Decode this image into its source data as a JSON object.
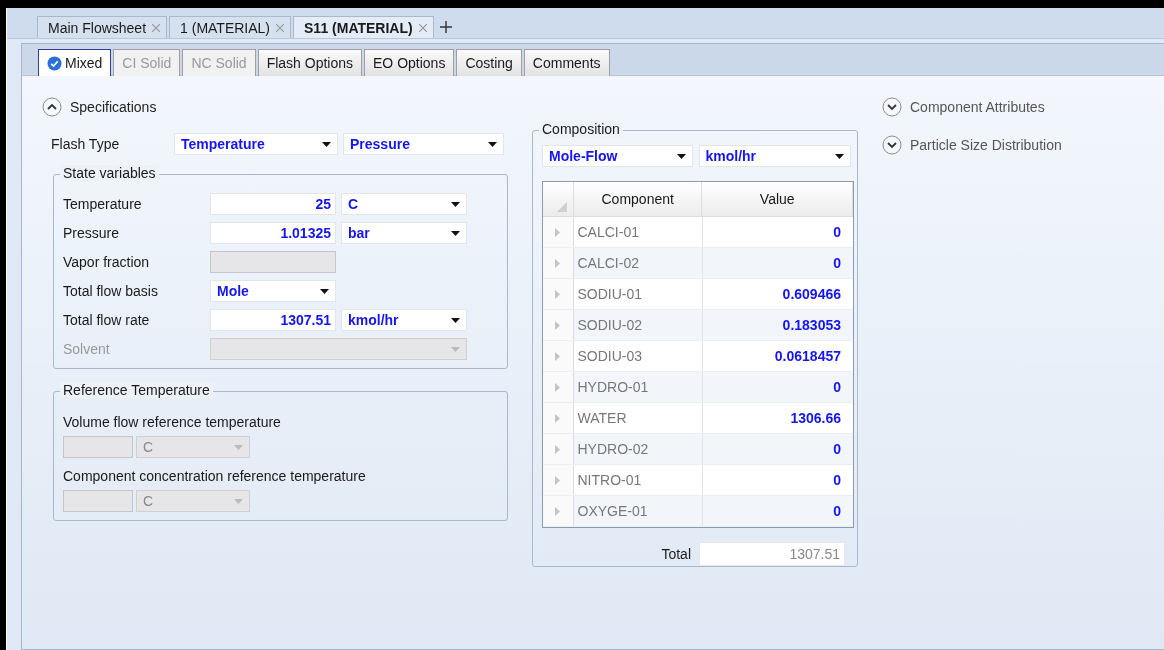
{
  "document_tabs": [
    {
      "label": "Main Flowsheet",
      "selected": false
    },
    {
      "label": "1 (MATERIAL)",
      "selected": false
    },
    {
      "label": "S11 (MATERIAL)",
      "selected": true
    }
  ],
  "form_tabs": [
    {
      "label": "Mixed",
      "selected": true,
      "disabled": false,
      "checked": true
    },
    {
      "label": "CI Solid",
      "selected": false,
      "disabled": true,
      "checked": false
    },
    {
      "label": "NC Solid",
      "selected": false,
      "disabled": true,
      "checked": false
    },
    {
      "label": "Flash Options",
      "selected": false,
      "disabled": false,
      "checked": false
    },
    {
      "label": "EO Options",
      "selected": false,
      "disabled": false,
      "checked": false
    },
    {
      "label": "Costing",
      "selected": false,
      "disabled": false,
      "checked": false
    },
    {
      "label": "Comments",
      "selected": false,
      "disabled": false,
      "checked": false
    }
  ],
  "specifications": {
    "title": "Specifications",
    "expanded": true,
    "flash_type": {
      "label": "Flash Type",
      "options": [
        "Temperature",
        "Pressure"
      ]
    },
    "state_variables": {
      "title": "State variables",
      "rows": [
        {
          "kind": "value_unit",
          "label": "Temperature",
          "value": "25",
          "unit": "C",
          "disabled": false
        },
        {
          "kind": "value_unit",
          "label": "Pressure",
          "value": "1.01325",
          "unit": "bar",
          "disabled": false
        },
        {
          "kind": "empty_input",
          "label": "Vapor fraction",
          "disabled": false
        },
        {
          "kind": "select",
          "label": "Total flow basis",
          "value": "Mole",
          "disabled": false
        },
        {
          "kind": "value_unit",
          "label": "Total flow rate",
          "value": "1307.51",
          "unit": "kmol/hr",
          "disabled": false
        },
        {
          "kind": "wide_select",
          "label": "Solvent",
          "disabled": true
        }
      ]
    },
    "reference_temperature": {
      "title": "Reference Temperature",
      "items": [
        {
          "label": "Volume flow reference temperature",
          "unit": "C"
        },
        {
          "label": "Component concentration reference temperature",
          "unit": "C"
        }
      ]
    }
  },
  "composition": {
    "title": "Composition",
    "basis": "Mole-Flow",
    "units": "kmol/hr",
    "columns": [
      "Component",
      "Value"
    ],
    "rows": [
      {
        "component": "CALCI-01",
        "value": "0"
      },
      {
        "component": "CALCI-02",
        "value": "0"
      },
      {
        "component": "SODIU-01",
        "value": "0.609466"
      },
      {
        "component": "SODIU-02",
        "value": "0.183053"
      },
      {
        "component": "SODIU-03",
        "value": "0.0618457"
      },
      {
        "component": "HYDRO-01",
        "value": "0"
      },
      {
        "component": "WATER",
        "value": "1306.66"
      },
      {
        "component": "HYDRO-02",
        "value": "0"
      },
      {
        "component": "NITRO-01",
        "value": "0"
      },
      {
        "component": "OXYGE-01",
        "value": "0"
      }
    ],
    "total_label": "Total",
    "total_value": "1307.51"
  },
  "side_sections": [
    {
      "title": "Component Attributes",
      "expanded": false
    },
    {
      "title": "Particle Size Distribution",
      "expanded": false
    }
  ]
}
